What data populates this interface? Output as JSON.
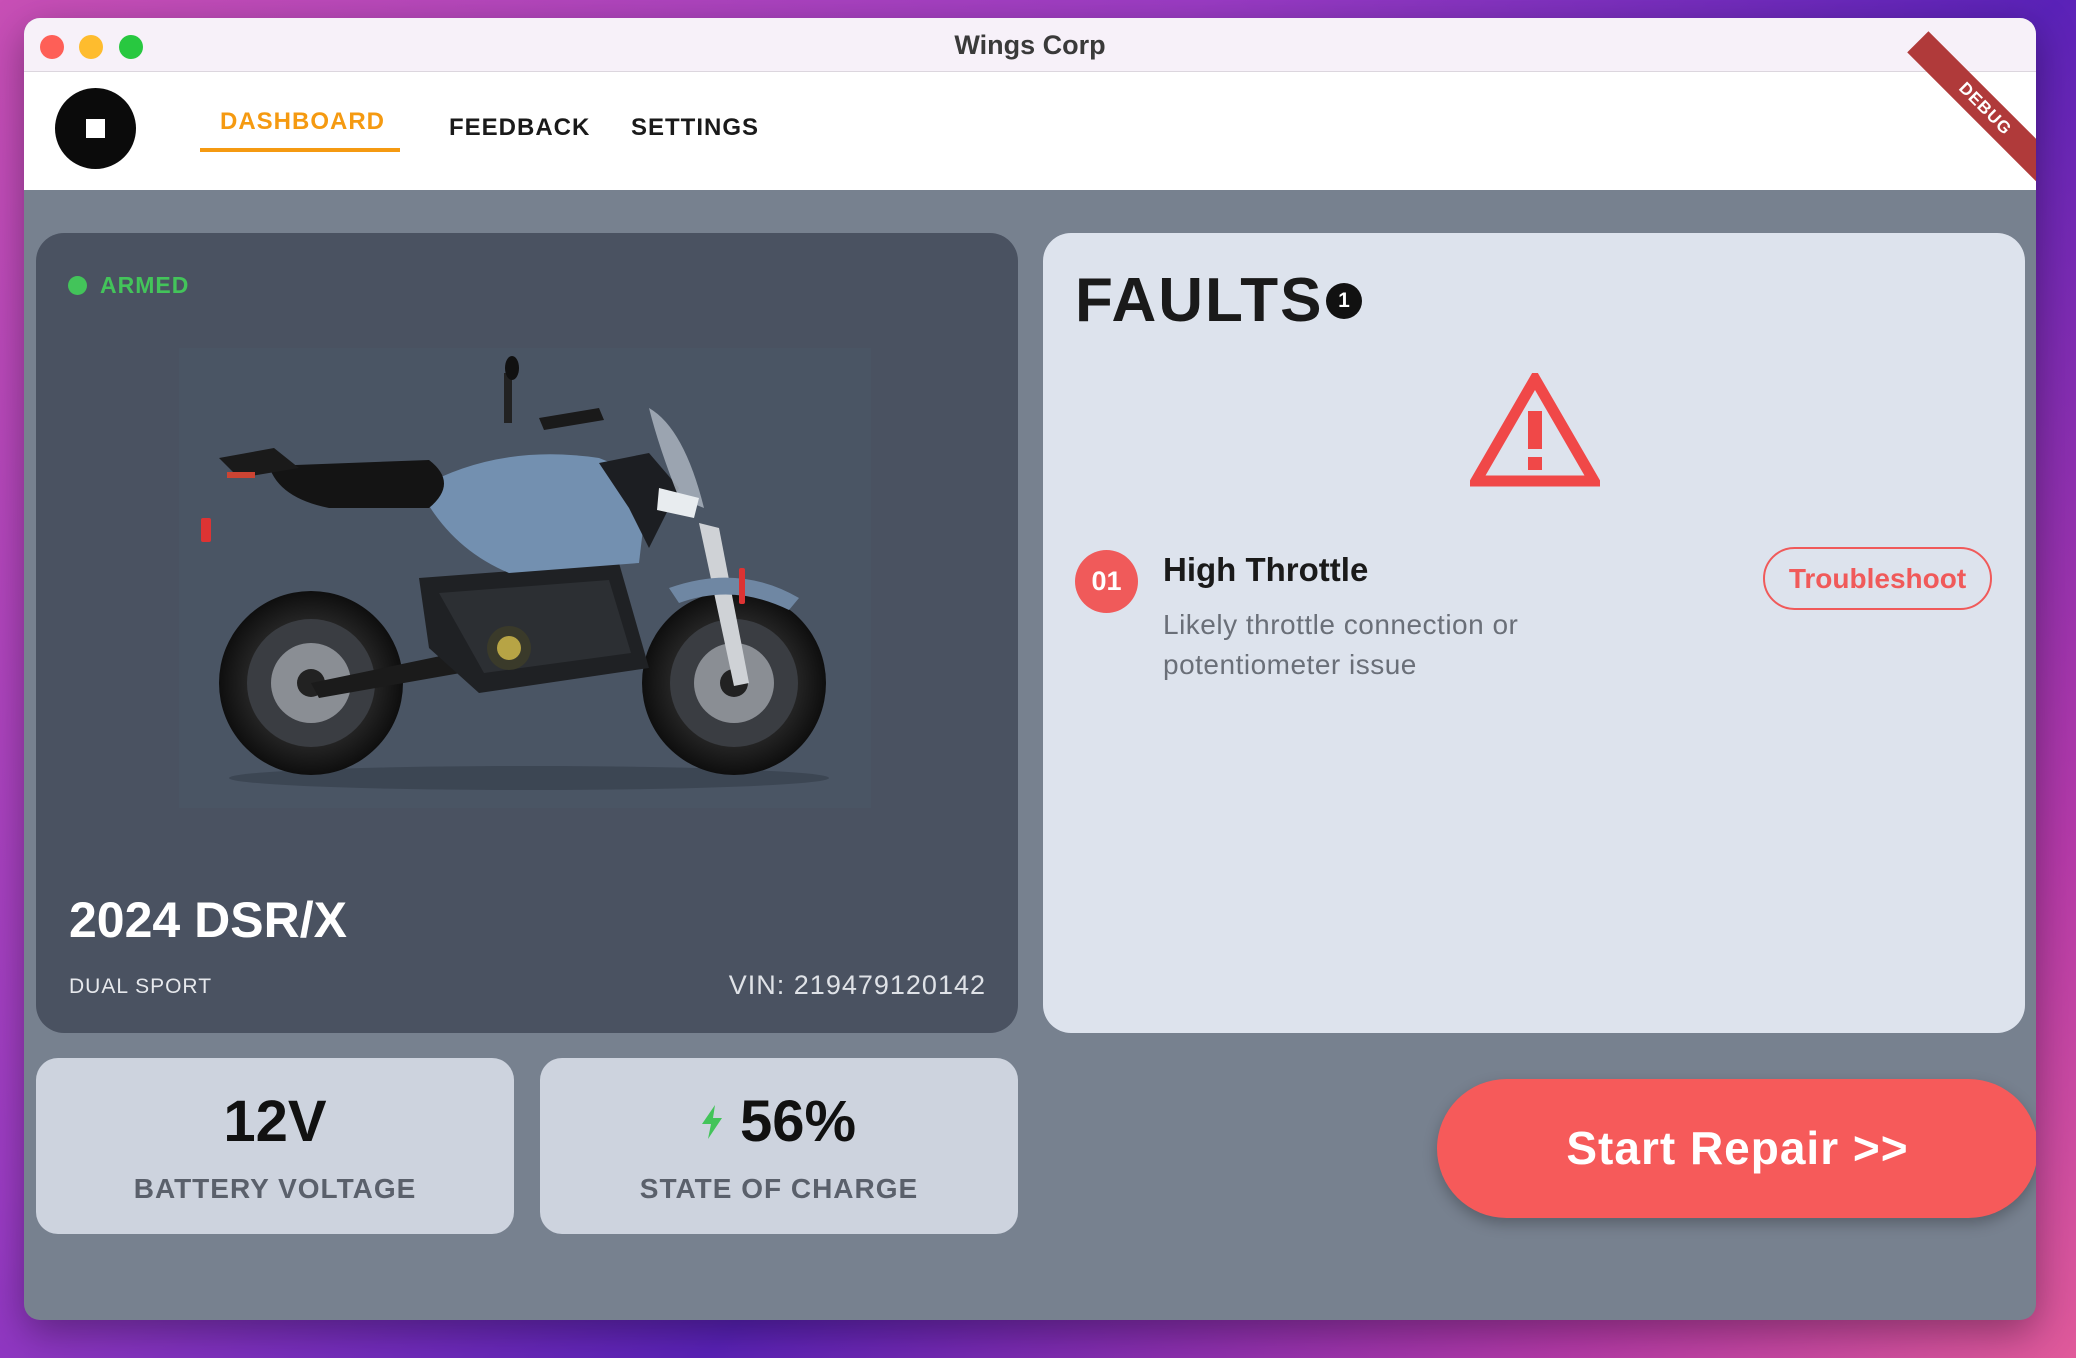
{
  "window": {
    "title": "Wings Corp"
  },
  "nav": {
    "items": [
      {
        "label": "DASHBOARD",
        "active": true
      },
      {
        "label": "FEEDBACK",
        "active": false
      },
      {
        "label": "SETTINGS",
        "active": false
      }
    ],
    "active_color": "#f59a11"
  },
  "debug_banner": "DEBUG",
  "vehicle": {
    "status": "ARMED",
    "status_color": "#43c45a",
    "name": "2024 DSR/X",
    "type": "DUAL SPORT",
    "vin": "VIN: 219479120142",
    "image": "motorcycle-photo"
  },
  "stats": {
    "battery_voltage": {
      "value": "12V",
      "label": "BATTERY VOLTAGE"
    },
    "state_of_charge": {
      "value": "56%",
      "label": "STATE OF CHARGE",
      "icon": "bolt-icon"
    }
  },
  "faults": {
    "title": "FAULTS",
    "count": "1",
    "icon": "warning-icon",
    "items": [
      {
        "number": "01",
        "title": "High Throttle",
        "description": "Likely throttle connection or potentiometer issue",
        "action": "Troubleshoot"
      }
    ]
  },
  "actions": {
    "start_repair": "Start Repair >>"
  },
  "colors": {
    "accent_red": "#f05a5a",
    "repair_button": "#f65a5a"
  }
}
